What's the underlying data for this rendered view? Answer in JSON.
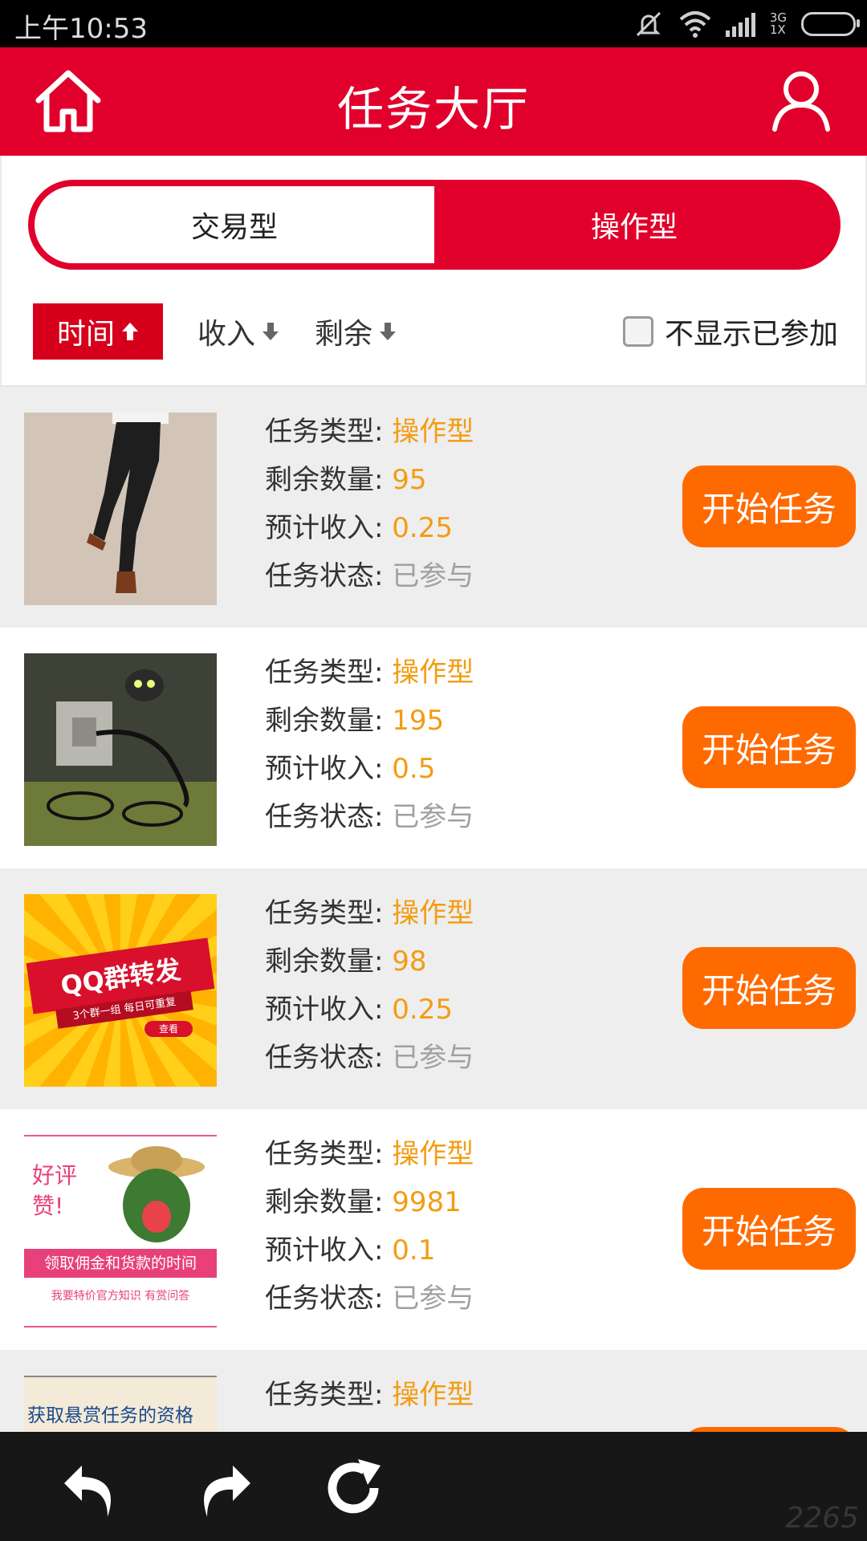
{
  "status_bar": {
    "time": "上午10:53",
    "network_top": "3G",
    "network_bottom": "1X",
    "icons": [
      "mute-icon",
      "wifi-icon",
      "signal-icon",
      "battery-icon"
    ]
  },
  "header": {
    "title": "任务大厅",
    "left_icon": "home-icon",
    "right_icon": "user-icon",
    "color": "#e0002b"
  },
  "tabs": [
    {
      "label": "交易型",
      "active": false
    },
    {
      "label": "操作型",
      "active": true
    }
  ],
  "sort": {
    "time_label": "时间",
    "income_label": "收入",
    "remaining_label": "剩余",
    "hide_joined_label": "不显示已参加",
    "hide_joined_checked": false
  },
  "labels": {
    "type": "任务类型:",
    "remaining": "剩余数量:",
    "income": "预计收入:",
    "status": "任务状态:",
    "start_button": "开始任务"
  },
  "tasks": [
    {
      "type": "操作型",
      "remaining": "95",
      "income": "0.25",
      "status": "已参与",
      "image": "pants-photo"
    },
    {
      "type": "操作型",
      "remaining": "195",
      "income": "0.5",
      "status": "已参与",
      "image": "usb-lamp-photo"
    },
    {
      "type": "操作型",
      "remaining": "98",
      "income": "0.25",
      "status": "已参与",
      "image": "qq-group-banner",
      "banner_title": "QQ群转发",
      "banner_sub": "3个群一组 每日可重复",
      "banner_btn": "查看"
    },
    {
      "type": "操作型",
      "remaining": "9981",
      "income": "0.1",
      "status": "已参与",
      "image": "watermelon-banner",
      "banner_top": "好评 赞!",
      "banner_mid": "领取佣金和货款的时间",
      "banner_bottom": "我要特价官方知识  有赏问答"
    },
    {
      "type": "操作型",
      "image": "reward-banner",
      "banner_text": "获取悬赏任务的资格"
    }
  ],
  "bottom_nav": [
    "back-icon",
    "forward-icon",
    "refresh-icon"
  ],
  "watermark": "2265"
}
